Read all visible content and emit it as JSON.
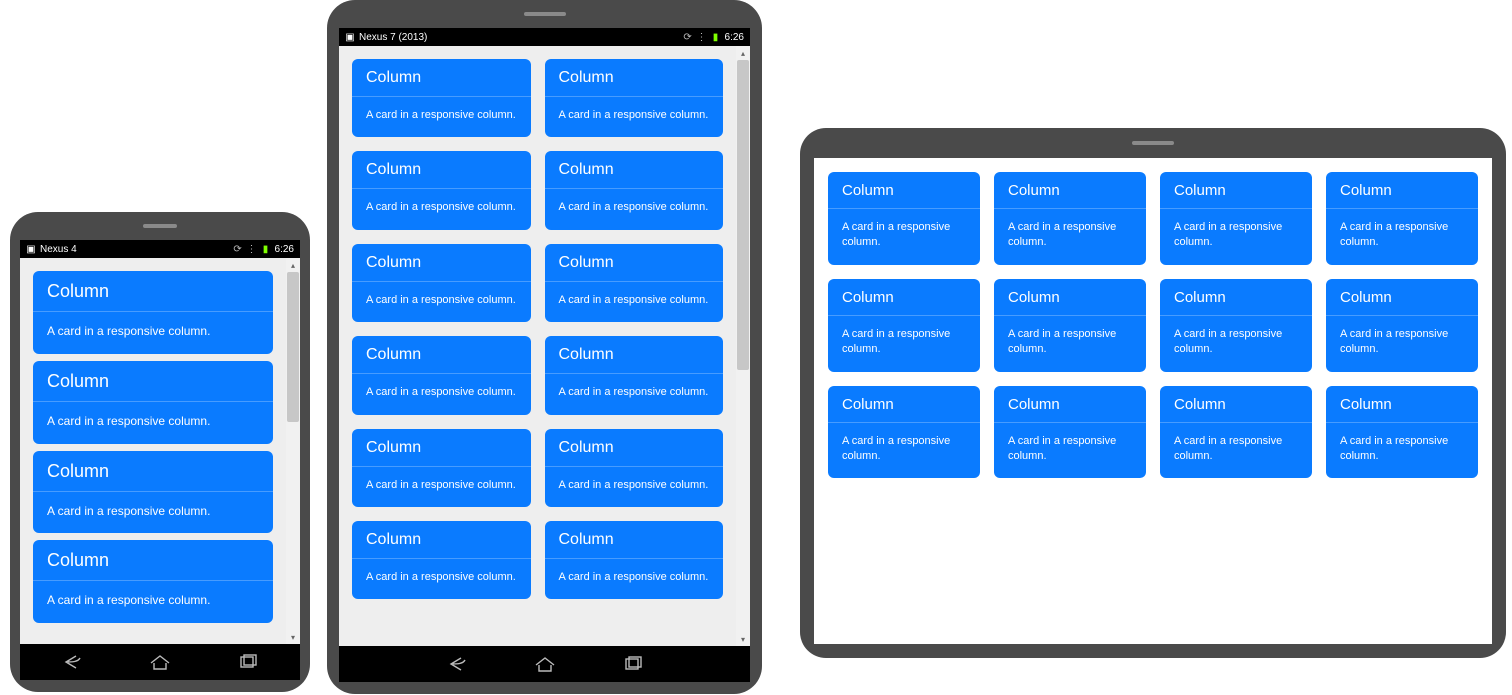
{
  "status": {
    "time": "6:26",
    "device1": "Nexus 4",
    "device2": "Nexus 7 (2013)"
  },
  "card": {
    "title": "Column",
    "body_long": "A card in a responsive column.",
    "body_wrap": "A card in a responsive column."
  },
  "nav": {
    "back": "back",
    "home": "home",
    "recent": "recent"
  },
  "device1_cards": [
    0,
    1,
    2,
    3
  ],
  "device2_cards": [
    0,
    1,
    2,
    3,
    4,
    5,
    6,
    7,
    8,
    9,
    10,
    11
  ],
  "device3_cards": [
    0,
    1,
    2,
    3,
    4,
    5,
    6,
    7,
    8,
    9,
    10,
    11
  ]
}
